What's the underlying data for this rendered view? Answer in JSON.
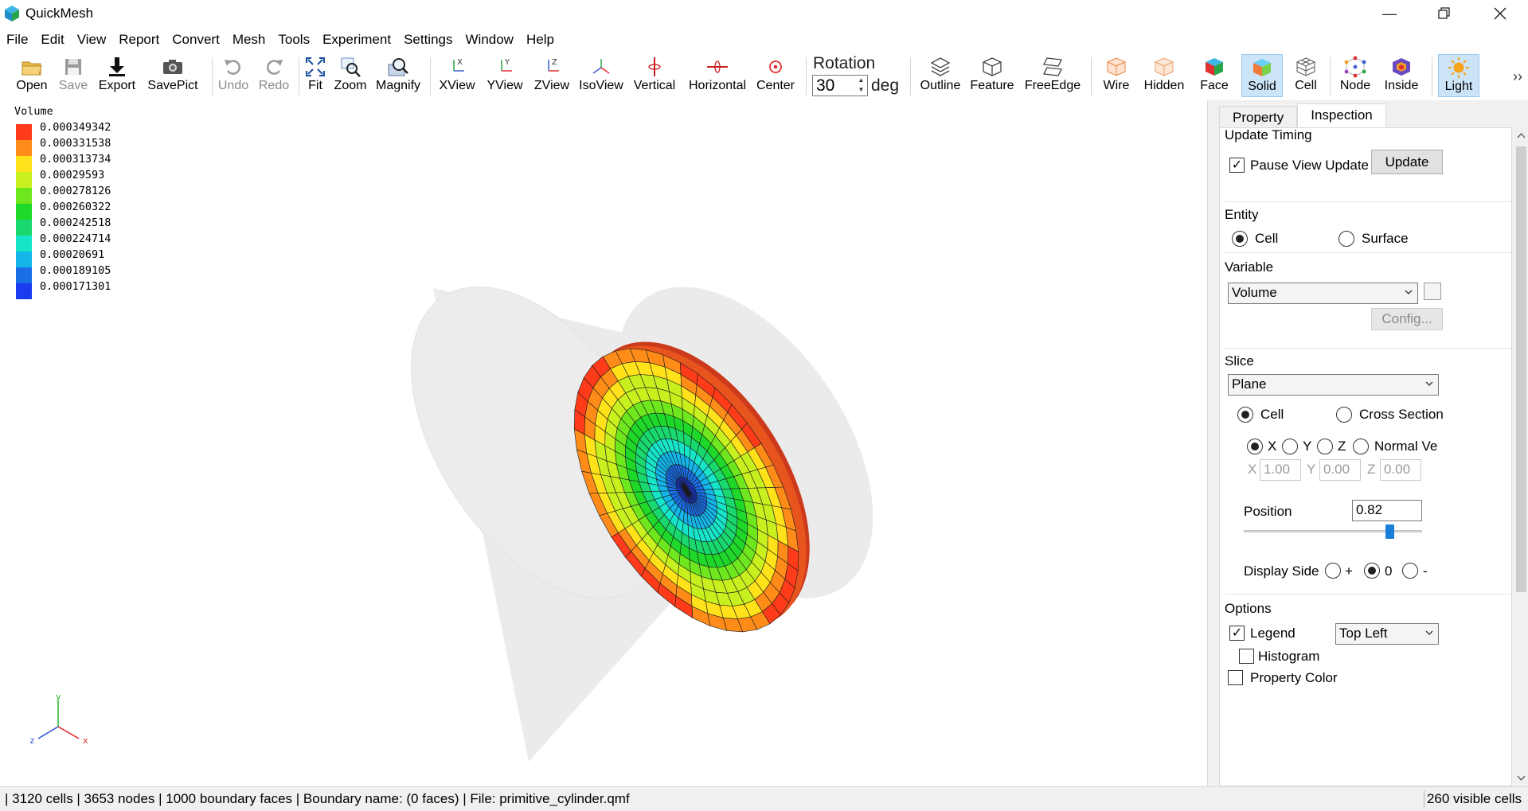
{
  "window": {
    "title": "QuickMesh"
  },
  "menu": [
    "File",
    "Edit",
    "View",
    "Report",
    "Convert",
    "Mesh",
    "Tools",
    "Experiment",
    "Settings",
    "Window",
    "Help"
  ],
  "toolbar": {
    "open": "Open",
    "save": "Save",
    "export": "Export",
    "savepict": "SavePict",
    "undo": "Undo",
    "redo": "Redo",
    "fit": "Fit",
    "zoom": "Zoom",
    "magnify": "Magnify",
    "xview": "XView",
    "yview": "YView",
    "zview": "ZView",
    "isoview": "IsoView",
    "vertical": "Vertical",
    "horizontal": "Horizontal",
    "center": "Center",
    "rotation_label": "Rotation",
    "rotation_value": "30",
    "rotation_unit": "deg",
    "outline": "Outline",
    "feature": "Feature",
    "freeedge": "FreeEdge",
    "wire": "Wire",
    "hidden": "Hidden",
    "face": "Face",
    "solid": "Solid",
    "cell": "Cell",
    "node": "Node",
    "inside": "Inside",
    "light": "Light"
  },
  "legend": {
    "title": "Volume",
    "entries": [
      {
        "value": "0.000349342",
        "color": "#ff3b1a"
      },
      {
        "value": "0.000331538",
        "color": "#ff8c19"
      },
      {
        "value": "0.000313734",
        "color": "#ffe21a"
      },
      {
        "value": "0.00029593",
        "color": "#c8f01e"
      },
      {
        "value": "0.000278126",
        "color": "#6fe71f"
      },
      {
        "value": "0.000260322",
        "color": "#1fd92a"
      },
      {
        "value": "0.000242518",
        "color": "#19d86e"
      },
      {
        "value": "0.000224714",
        "color": "#17e5c9"
      },
      {
        "value": "0.00020691",
        "color": "#14b6ea"
      },
      {
        "value": "0.000189105",
        "color": "#1a6ee6"
      },
      {
        "value": "0.000171301",
        "color": "#1a3cf0"
      }
    ]
  },
  "axes": {
    "y": "y",
    "z": "z",
    "x": "x"
  },
  "panel": {
    "tabs": [
      "Property",
      "Inspection"
    ],
    "update_timing": {
      "title": "Update Timing",
      "pause_label": "Pause View Update",
      "update_button": "Update"
    },
    "entity": {
      "title": "Entity",
      "cell": "Cell",
      "surface": "Surface"
    },
    "variable": {
      "title": "Variable",
      "selected": "Volume",
      "config_button": "Config..."
    },
    "slice": {
      "title": "Slice",
      "mode": "Plane",
      "cell": "Cell",
      "cross_section": "Cross Section",
      "x": "X",
      "y": "Y",
      "z": "Z",
      "normal": "Normal Ve",
      "nx_label": "X",
      "nx": "1.00",
      "ny_label": "Y",
      "ny": "0.00",
      "nz_label": "Z",
      "nz": "0.00",
      "position_label": "Position",
      "position_value": "0.82",
      "position_slider": 0.82,
      "display_side_label": "Display Side",
      "plus": "+",
      "zero": "0",
      "minus": "-"
    },
    "options": {
      "title": "Options",
      "legend": "Legend",
      "legend_position": "Top Left",
      "histogram": "Histogram",
      "property_color": "Property Color"
    }
  },
  "status": {
    "left": "| 3120 cells | 3653 nodes | 1000 boundary faces |  Boundary name:  (0 faces) | File: primitive_cylinder.qmf",
    "right": "260 visible cells"
  }
}
